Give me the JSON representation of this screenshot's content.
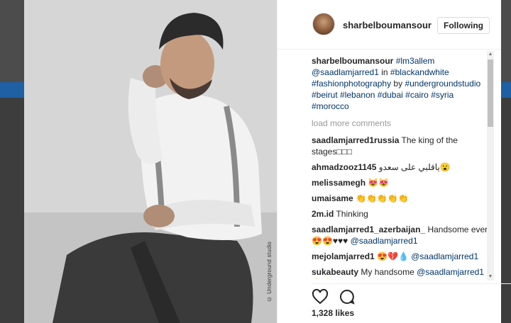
{
  "post": {
    "username": "sharbelboumansour",
    "follow_label": "Following",
    "photo_credit": "© Underground studio",
    "caption": {
      "username": "sharbelboumansour",
      "parts": [
        {
          "t": "tag",
          "v": "#lm3allem"
        },
        {
          "t": "txt",
          "v": " "
        },
        {
          "t": "tag",
          "v": "@saadlamjarred1"
        },
        {
          "t": "txt",
          "v": " in "
        },
        {
          "t": "tag",
          "v": "#blackandwhite"
        },
        {
          "t": "txt",
          "v": " "
        },
        {
          "t": "tag",
          "v": "#fashionphotography"
        },
        {
          "t": "txt",
          "v": " by "
        },
        {
          "t": "tag",
          "v": "#undergroundstudio"
        },
        {
          "t": "txt",
          "v": " "
        },
        {
          "t": "tag",
          "v": "#beirut"
        },
        {
          "t": "txt",
          "v": " "
        },
        {
          "t": "tag",
          "v": "#lebanon"
        },
        {
          "t": "txt",
          "v": " "
        },
        {
          "t": "tag",
          "v": "#dubai"
        },
        {
          "t": "txt",
          "v": " "
        },
        {
          "t": "tag",
          "v": "#cairo"
        },
        {
          "t": "txt",
          "v": " "
        },
        {
          "t": "tag",
          "v": "#syria"
        },
        {
          "t": "txt",
          "v": " "
        },
        {
          "t": "tag",
          "v": "#morocco"
        }
      ]
    },
    "load_more_label": "load more comments",
    "comments": [
      {
        "user": "saadlamjarred1russia",
        "parts": [
          {
            "t": "txt",
            "v": "The king of the stages□□□"
          }
        ]
      },
      {
        "user": "ahmadzooz1145",
        "parts": [
          {
            "t": "txt",
            "v": "ياقلبي على سعدو😮"
          }
        ]
      },
      {
        "user": "melissamegh",
        "parts": [
          {
            "t": "txt",
            "v": "😻😻"
          }
        ]
      },
      {
        "user": "umaisame",
        "parts": [
          {
            "t": "txt",
            "v": "👏👏👏👏👏"
          }
        ]
      },
      {
        "user": "2m.id",
        "parts": [
          {
            "t": "txt",
            "v": "Thinking"
          }
        ]
      },
      {
        "user": "saadlamjarred1_azerbaijan_",
        "parts": [
          {
            "t": "txt",
            "v": "Handsome ever😍😍♥♥♥ "
          },
          {
            "t": "tag",
            "v": "@saadlamjarred1"
          }
        ]
      },
      {
        "user": "mejolamjarred1",
        "parts": [
          {
            "t": "txt",
            "v": "😍💔💧 "
          },
          {
            "t": "tag",
            "v": "@saadlamjarred1"
          }
        ]
      },
      {
        "user": "sukabeauty",
        "parts": [
          {
            "t": "txt",
            "v": "My handsome "
          },
          {
            "t": "tag",
            "v": "@saadlamjarred1"
          },
          {
            "t": "txt",
            "v": " 😍😍"
          }
        ]
      }
    ],
    "likes": "1,328 likes",
    "icons": [
      "heart-icon",
      "comment-icon"
    ]
  }
}
